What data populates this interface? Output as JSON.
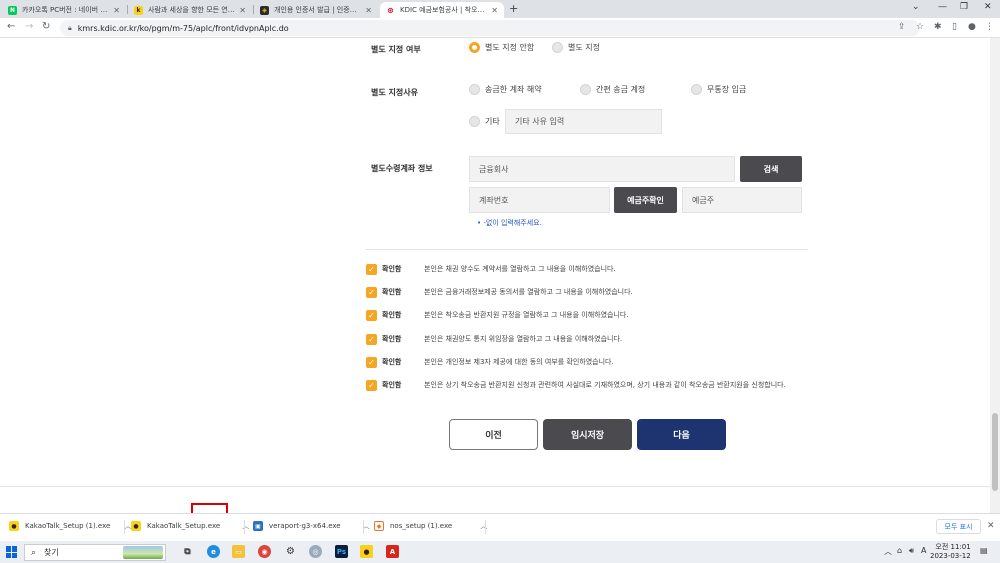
{
  "browser": {
    "tabs": [
      {
        "title": "카카오톡 PC버전 : 네이버 통합검색",
        "favicon_color": "#03c75a",
        "favicon_glyph": "N"
      },
      {
        "title": "사람과 세상을 향한 모든 연결이",
        "favicon_color": "#f7d21a",
        "favicon_glyph": "k"
      },
      {
        "title": "개인용 인증서 발급 | 인증센터",
        "favicon_color": "#2b2b2b",
        "favicon_glyph": "◈"
      },
      {
        "title": "KDIC 예금보험공사 | 착오송금반환",
        "favicon_color": "#c8102e",
        "favicon_glyph": "⊛",
        "active": true
      }
    ],
    "new_tab": "+",
    "window_controls": [
      "⌄",
      "—",
      "❐",
      "✕"
    ],
    "address": "kmrs.kdic.or.kr/ko/pgm/m-75/aplc/front/idvpnAplc.do"
  },
  "form": {
    "designation": {
      "label": "별도 지정 여부",
      "options": [
        {
          "label": "별도 지정 안함",
          "selected": true
        },
        {
          "label": "별도 지정",
          "selected": false
        }
      ]
    },
    "reason": {
      "label": "별도 지정사유",
      "options": [
        "송금한 계좌 해약",
        "간편 송금 계정",
        "무통장 입금",
        "기타"
      ],
      "other_placeholder": "기타 사유 입력"
    },
    "account": {
      "label": "별도수령계좌 정보",
      "bank_placeholder": "금융회사",
      "search_button": "검색",
      "account_placeholder": "계좌번호",
      "verify_button": "예금주확인",
      "holder_placeholder": "예금주",
      "hint": "• -없이 입력해주세요."
    },
    "agreements": {
      "label": "확인함",
      "items": [
        "본인은 채권 양수도 계약서를 열람하고 그 내용을 이해하였습니다.",
        "본인은 금융거래정보제공 동의서를 열람하고 그 내용을 이해하였습니다.",
        "본인은 착오송금 반환지원 규정을 열람하고 그 내용을 이해하였습니다.",
        "본인은 채권양도 통지 위임장을 열람하고 그 내용을 이해하였습니다.",
        "본인은 개인정보 제3자 제공에 대한 동의 여부를 확인하였습니다.",
        "본인은 상기 착오송금 반환지원 신청과 관련하여 사실대로 기재하였으며, 상기 내용과 같이 착오송금 반환지원을 신청합니다."
      ]
    },
    "buttons": {
      "prev": "이전",
      "save": "임시저장",
      "next": "다음"
    },
    "colors": {
      "accent": "#f5a623",
      "next_bg": "#1e3470",
      "dark_btn": "#4a4a4f"
    }
  },
  "downloads": {
    "items": [
      {
        "name": "KakaoTalk_Setup (1).exe",
        "icon": "kakao-icon"
      },
      {
        "name": "KakaoTalk_Setup.exe",
        "icon": "kakao-icon"
      },
      {
        "name": "veraport-g3-x64.exe",
        "icon": "installer-icon"
      },
      {
        "name": "nos_setup (1).exe",
        "icon": "shield-icon"
      }
    ],
    "show_all": "모두 표시"
  },
  "taskbar": {
    "search": "찾기",
    "clock_time": "오전 11:01",
    "clock_date": "2023-03-12",
    "ime": "A"
  }
}
